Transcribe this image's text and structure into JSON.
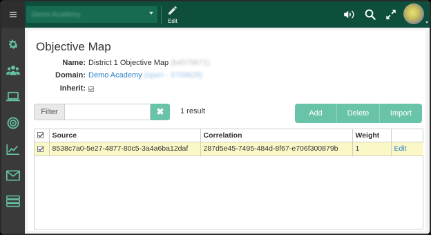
{
  "topbar": {
    "app_select_value": "Demo Academy",
    "edit_label": "Edit"
  },
  "sidebar": {
    "menu_icon": "hamburger-icon",
    "items": [
      {
        "icon": "gear-icon"
      },
      {
        "icon": "users-icon"
      },
      {
        "icon": "laptop-icon"
      },
      {
        "icon": "target-icon"
      },
      {
        "icon": "chart-icon"
      },
      {
        "icon": "envelope-icon"
      },
      {
        "icon": "server-icon"
      }
    ]
  },
  "page": {
    "title": "Objective Map",
    "name_label": "Name:",
    "name_value": "District 1 Objective Map",
    "name_hidden": "(b4579871)",
    "domain_label": "Domain:",
    "domain_value": "Demo Academy",
    "domain_hidden": "(open - 3709829)",
    "inherit_label": "Inherit:"
  },
  "filter": {
    "label": "Filter",
    "value": "",
    "placeholder": "",
    "clear_icon": "close-icon",
    "result_text": "1 result"
  },
  "actions": {
    "add": "Add",
    "delete": "Delete",
    "import": "Import"
  },
  "table": {
    "headers": [
      "Source",
      "Correlation",
      "Weight",
      ""
    ],
    "rows": [
      {
        "source": "8538c7a0-5e27-4877-80c5-3a4a6ba12daf",
        "correlation": "287d5e45-7495-484d-8f67-e706f300879b",
        "weight": "1",
        "action": "Edit"
      }
    ]
  },
  "colors": {
    "topbar": "#0d4f3c",
    "sidebar": "#3a3a3a",
    "accent": "#69c3a8",
    "link": "#2a7fc7",
    "selected_row": "#fbf8c8"
  }
}
